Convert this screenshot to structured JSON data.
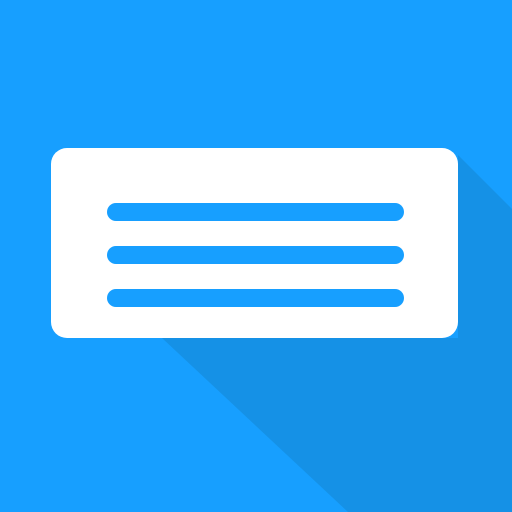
{
  "icon": {
    "name": "text-lines-card-app-icon",
    "colors": {
      "background": "#179FFF",
      "long_shadow": "#1591E6",
      "card": "#FFFFFF",
      "lines": "#179FFF"
    },
    "line_count": 3
  }
}
